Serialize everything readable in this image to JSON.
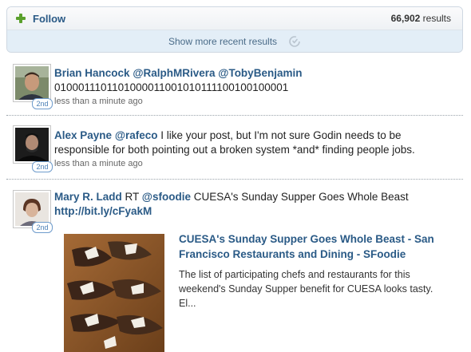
{
  "header": {
    "follow_label": "Follow",
    "results_count": "66,902",
    "results_suffix": "results",
    "show_more_label": "Show more recent results"
  },
  "tweets": [
    {
      "author": "Brian Hancock",
      "mention1": "@RalphMRivera",
      "mention2": "@TobyBenjamin",
      "text": "0100011101101000011001010111100100100001",
      "time": "less than a minute ago",
      "badge": "2nd"
    },
    {
      "author": "Alex Payne",
      "mention1": "@rafeco",
      "text": " I like your post, but I'm not sure Godin needs to be responsible for both pointing out a broken system *and* finding people jobs.",
      "time": "less than a minute ago",
      "badge": "2nd"
    },
    {
      "author": "Mary R. Ladd",
      "prefix": " RT ",
      "mention1": "@sfoodie",
      "text": " CUESA's Sunday Supper Goes Whole Beast ",
      "link": "http://bit.ly/cFyakM",
      "badge": "2nd",
      "preview": {
        "title": "CUESA's Sunday Supper Goes Whole Beast - San Francisco Restaurants and Dining - SFoodie",
        "description": "The list of participating chefs and restaurants for this weekend's Sunday Supper benefit for CUESA looks tasty. El..."
      }
    }
  ],
  "colors": {
    "link": "#2a5a86",
    "follow_plus": "#5aa02c",
    "show_more_bg": "#e3eef7",
    "badge_border": "#6f9ccc"
  },
  "icons": [
    "plus-icon",
    "refresh-icon"
  ]
}
